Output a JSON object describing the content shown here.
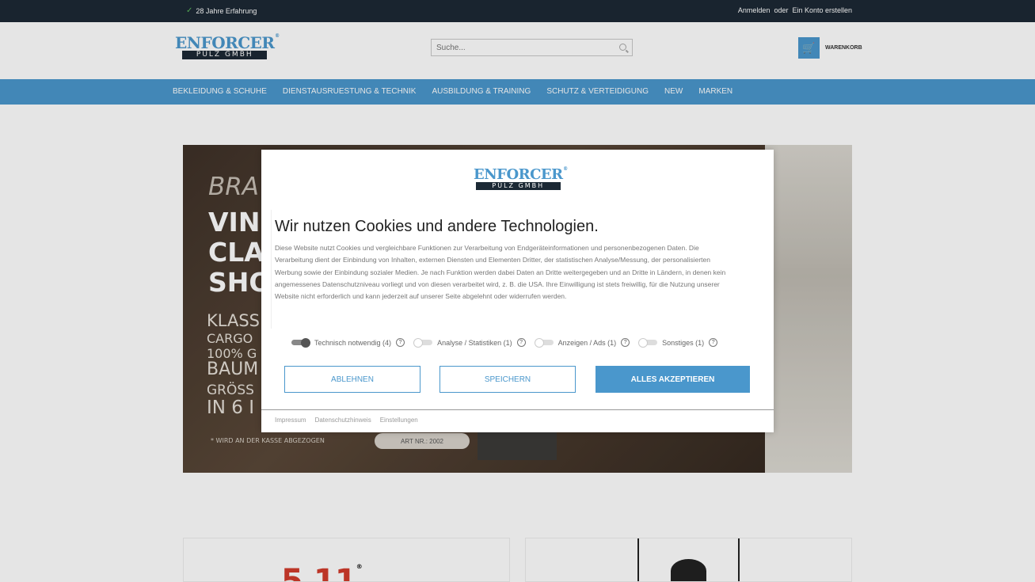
{
  "topbar": {
    "experience": "28 Jahre Erfahrung",
    "login": "Anmelden",
    "or": "oder",
    "register": "Ein Konto erstellen"
  },
  "header": {
    "logo_top": "ENFORCER",
    "logo_bottom": "PÜLZ GMBH",
    "search_placeholder": "Suche...",
    "cart_label": "WARENKORB"
  },
  "nav": [
    "BEKLEIDUNG & SCHUHE",
    "DIENSTAUSRUESTUNG & TECHNIK",
    "AUSBILDUNG & TRAINING",
    "SCHUTZ & VERTEIDIGUNG",
    "NEW",
    "MARKEN"
  ],
  "hero": {
    "brand_partial": "BRA",
    "headline": [
      "VIN",
      "CLA",
      "SHO"
    ],
    "features": [
      "KLASS",
      "CARGO",
      "100% G",
      "BAUM",
      "GRÖSS",
      "IN 6 I"
    ],
    "note": "* WIRD AN DER KASSE ABGEZOGEN",
    "art": "ART NR.: 2002"
  },
  "brands": {
    "card1": "5.11",
    "card1_mark": "®"
  },
  "cookie": {
    "logo_top": "ENFORCER",
    "logo_bottom": "PÜLZ GMBH",
    "title": "Wir nutzen Cookies und andere Technologien.",
    "description": "Diese Website nutzt Cookies und vergleichbare Funktionen zur Verarbeitung von Endgeräteinformationen und personenbezogenen Daten. Die Verarbeitung dient der Einbindung von Inhalten, externen Diensten und Elementen Dritter, der statistischen Analyse/Messung, der personalisierten Werbung sowie der Einbindung sozialer Medien. Je nach Funktion werden dabei Daten an Dritte weitergegeben und an Dritte in Ländern, in denen kein angemessenes Datenschutzniveau vorliegt und von diesen verarbeitet wird, z. B. die USA. Ihre Einwilligung ist stets freiwillig, für die Nutzung unserer Website nicht erforderlich und kann jederzeit auf unserer Seite abgelehnt oder widerrufen werden.",
    "toggles": [
      {
        "label": "Technisch notwendig (4)",
        "on": true
      },
      {
        "label": "Analyse / Statistiken (1)",
        "on": false
      },
      {
        "label": "Anzeigen / Ads (1)",
        "on": false
      },
      {
        "label": "Sonstiges (1)",
        "on": false
      }
    ],
    "help": "?",
    "buttons": {
      "decline": "ABLEHNEN",
      "save": "SPEICHERN",
      "accept": "ALLES AKZEPTIEREN"
    },
    "footer": [
      "Impressum",
      "Datenschutzhinweis",
      "Einstellungen"
    ]
  },
  "colors": {
    "accent": "#4a97cc",
    "topbar": "#1c2935"
  }
}
